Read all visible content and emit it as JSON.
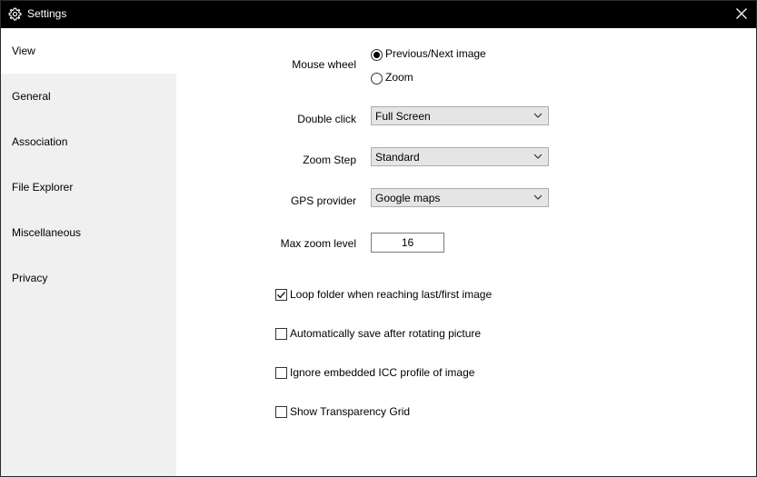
{
  "window": {
    "title": "Settings"
  },
  "sidebar": {
    "items": [
      {
        "label": "View"
      },
      {
        "label": "General"
      },
      {
        "label": "Association"
      },
      {
        "label": "File Explorer"
      },
      {
        "label": "Miscellaneous"
      },
      {
        "label": "Privacy"
      }
    ],
    "active": "View"
  },
  "view": {
    "mouse_wheel": {
      "label": "Mouse wheel",
      "options": [
        "Previous/Next image",
        "Zoom"
      ],
      "selected": "Previous/Next image"
    },
    "double_click": {
      "label": "Double click",
      "value": "Full Screen"
    },
    "zoom_step": {
      "label": "Zoom Step",
      "value": "Standard"
    },
    "gps_provider": {
      "label": "GPS provider",
      "value": "Google maps"
    },
    "max_zoom": {
      "label": "Max zoom level",
      "value": "16"
    },
    "checkboxes": [
      {
        "label": "Loop folder when reaching last/first image",
        "checked": true
      },
      {
        "label": "Automatically save after rotating picture",
        "checked": false
      },
      {
        "label": "Ignore embedded ICC profile of image",
        "checked": false
      },
      {
        "label": "Show Transparency Grid",
        "checked": false
      }
    ]
  }
}
